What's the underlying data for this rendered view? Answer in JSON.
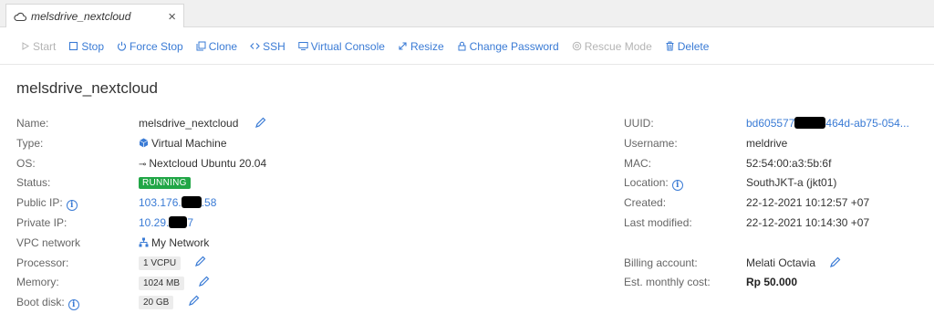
{
  "tab": {
    "title": "melsdrive_nextcloud",
    "close": "×"
  },
  "toolbar": {
    "start": "Start",
    "stop": "Stop",
    "force_stop": "Force Stop",
    "clone": "Clone",
    "ssh": "SSH",
    "virtual_console": "Virtual Console",
    "resize": "Resize",
    "change_password": "Change Password",
    "rescue_mode": "Rescue Mode",
    "delete": "Delete"
  },
  "title": "melsdrive_nextcloud",
  "left": {
    "name_label": "Name:",
    "name_value": "melsdrive_nextcloud",
    "type_label": "Type:",
    "type_value": "Virtual Machine",
    "os_label": "OS:",
    "os_value": "Nextcloud Ubuntu 20.04",
    "status_label": "Status:",
    "status_value": "RUNNING",
    "public_ip_label": "Public IP:",
    "public_ip_prefix": "103.176.",
    "public_ip_suffix": ".58",
    "private_ip_label": "Private IP:",
    "private_ip_prefix": "10.29.",
    "private_ip_suffix": "7",
    "vpc_label": "VPC network",
    "vpc_value": "My Network",
    "processor_label": "Processor:",
    "processor_value": "1 VCPU",
    "memory_label": "Memory:",
    "memory_value": "1024 MB",
    "boot_disk_label": "Boot disk:",
    "boot_disk_value": "20 GB"
  },
  "right": {
    "uuid_label": "UUID:",
    "uuid_prefix": "bd605577",
    "uuid_suffix": "464d-ab75-054...",
    "username_label": "Username:",
    "username_value": "meldrive",
    "mac_label": "MAC:",
    "mac_value": "52:54:00:a3:5b:6f",
    "location_label": "Location:",
    "location_value": "SouthJKT-a (jkt01)",
    "created_label": "Created:",
    "created_value": "22-12-2021 10:12:57 +07",
    "modified_label": "Last modified:",
    "modified_value": "22-12-2021 10:14:30 +07",
    "billing_label": "Billing account:",
    "billing_value": "Melati Octavia",
    "cost_label": "Est. monthly cost:",
    "cost_value": "Rp 50.000"
  },
  "colors": {
    "accent": "#3a7bd5",
    "running": "#21a646",
    "disabled": "#b4b4b4"
  }
}
